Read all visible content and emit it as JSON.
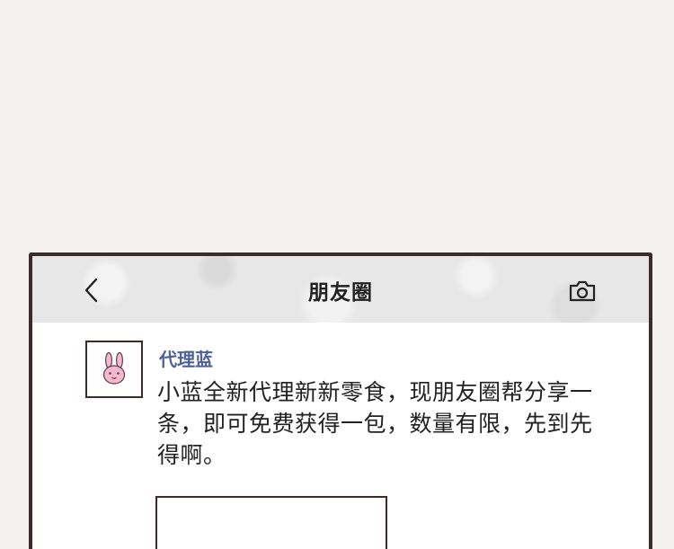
{
  "nav": {
    "title": "朋友圈",
    "back_icon": "chevron-left-icon",
    "camera_icon": "camera-icon"
  },
  "post": {
    "username": "代理蓝",
    "avatar_icon": "bunny-avatar-icon",
    "text": "小蓝全新代理新新零食，现朋友圈帮分享一条，即可免费获得一包，数量有限，先到先得啊。"
  },
  "colors": {
    "page_bg": "#f4f2ee",
    "frame": "#3d2a2a",
    "username": "#4e6196",
    "avatar_pink": "#f4b8cf"
  }
}
